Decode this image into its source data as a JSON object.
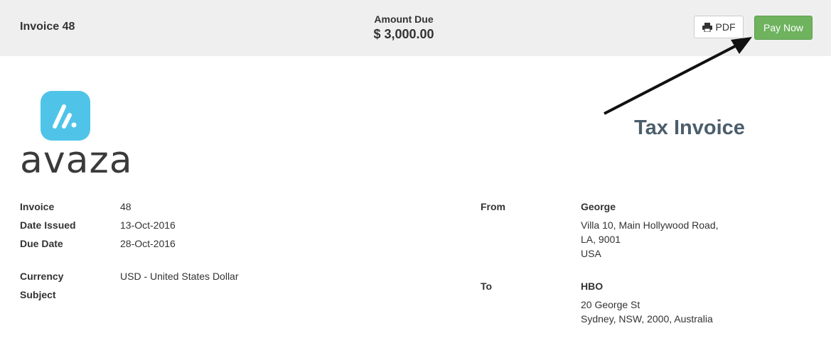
{
  "header": {
    "invoice_title": "Invoice 48",
    "amount_due_label": "Amount Due",
    "amount_due_value": "$ 3,000.00",
    "pdf_label": "PDF",
    "pay_now_label": "Pay Now"
  },
  "logo": {
    "text": "avaza",
    "icon": "avaza-logo-icon",
    "brand_color": "#4fc4e8"
  },
  "document_title": "Tax Invoice",
  "details": {
    "invoice_label": "Invoice",
    "invoice_value": "48",
    "date_issued_label": "Date Issued",
    "date_issued_value": "13-Oct-2016",
    "due_date_label": "Due Date",
    "due_date_value": "28-Oct-2016",
    "currency_label": "Currency",
    "currency_value": "USD - United States Dollar",
    "subject_label": "Subject",
    "subject_value": ""
  },
  "from": {
    "label": "From",
    "name": "George",
    "address": [
      "Villa 10, Main Hollywood Road,",
      "LA, 9001",
      "USA"
    ]
  },
  "to": {
    "label": "To",
    "name": "HBO",
    "address": [
      "20 George St",
      "Sydney, NSW, 2000, Australia"
    ]
  },
  "colors": {
    "pay_button": "#6fb35f",
    "title_color": "#4b5e6c",
    "header_bg": "#efefef"
  }
}
